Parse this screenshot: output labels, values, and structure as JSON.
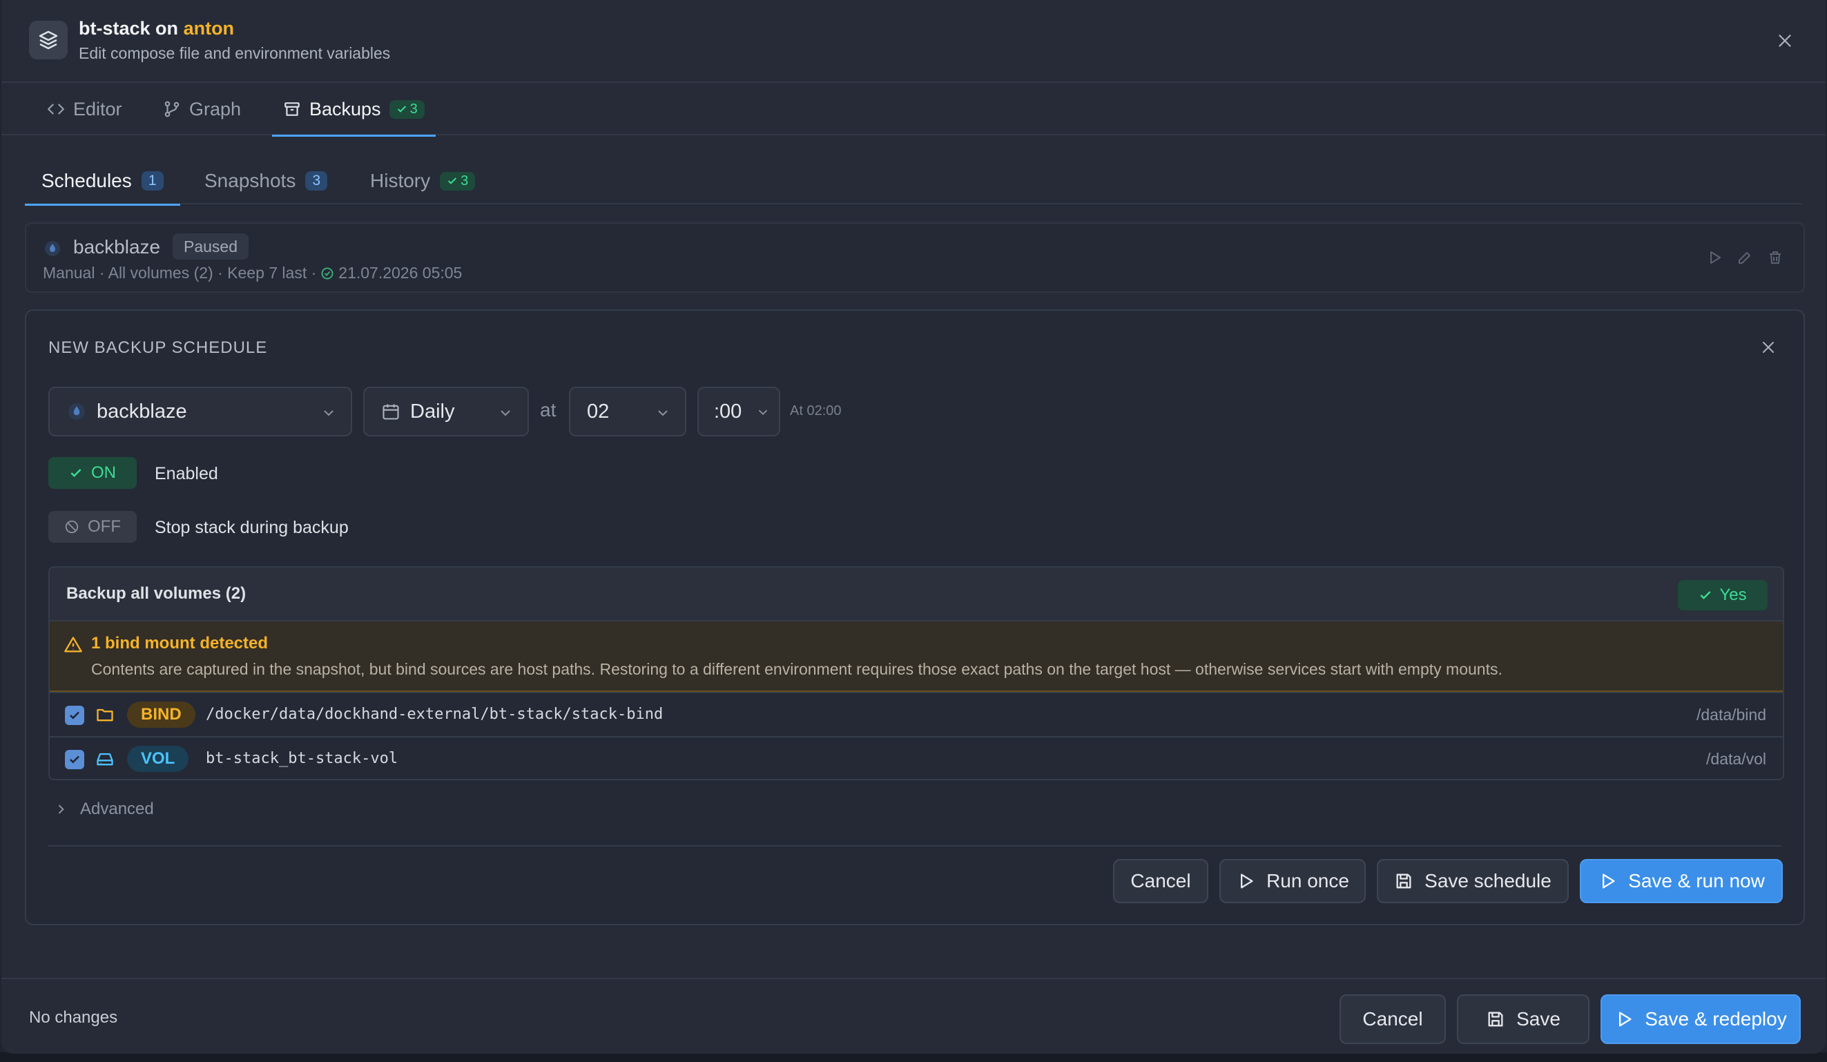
{
  "header": {
    "stack_name": "bt-stack",
    "on_word": "on",
    "host": "anton",
    "subtitle": "Edit compose file and environment variables"
  },
  "main_tabs": [
    {
      "label": "Editor",
      "icon": "code-icon"
    },
    {
      "label": "Graph",
      "icon": "graph-icon"
    },
    {
      "label": "Backups",
      "icon": "archive-icon",
      "badge": "3",
      "active": true
    }
  ],
  "sub_tabs": [
    {
      "label": "Schedules",
      "badge": "1",
      "active": true
    },
    {
      "label": "Snapshots",
      "badge": "3"
    },
    {
      "label": "History",
      "badge": "3"
    }
  ],
  "schedule": {
    "name": "backblaze",
    "status": "Paused",
    "meta": "Manual · All volumes (2) · Keep 7 last ·",
    "last_run": "21.07.2026 05:05"
  },
  "form": {
    "title": "NEW BACKUP SCHEDULE",
    "target": "backblaze",
    "frequency": "Daily",
    "at_label": "at",
    "hour": "02",
    "minute": ":00",
    "at_hint": "At 02:00",
    "enabled_toggle": "ON",
    "enabled_label": "Enabled",
    "stop_toggle": "OFF",
    "stop_label": "Stop stack during backup",
    "backup_all_label": "Backup all volumes (2)",
    "backup_all_value": "Yes",
    "warning_title": "1 bind mount detected",
    "warning_text": "Contents are captured in the snapshot, but bind sources are host paths. Restoring to a different environment requires those exact paths on the target host — otherwise services start with empty mounts.",
    "volumes": [
      {
        "type": "BIND",
        "source": "/docker/data/dockhand-external/bt-stack/stack-bind",
        "mount": "/data/bind",
        "checked": true
      },
      {
        "type": "VOL",
        "source": "bt-stack_bt-stack-vol",
        "mount": "/data/vol",
        "checked": true
      }
    ],
    "advanced_label": "Advanced",
    "buttons": {
      "cancel": "Cancel",
      "run_once": "Run once",
      "save_schedule": "Save schedule",
      "save_run": "Save & run now"
    }
  },
  "footer": {
    "status": "No changes",
    "cancel": "Cancel",
    "save": "Save",
    "save_redeploy": "Save & redeploy"
  },
  "colors": {
    "accent": "#3b8fe8",
    "success": "#3ddc97",
    "warning": "#f5b32a",
    "volume": "#4cc3ff",
    "background": "#262b37"
  }
}
